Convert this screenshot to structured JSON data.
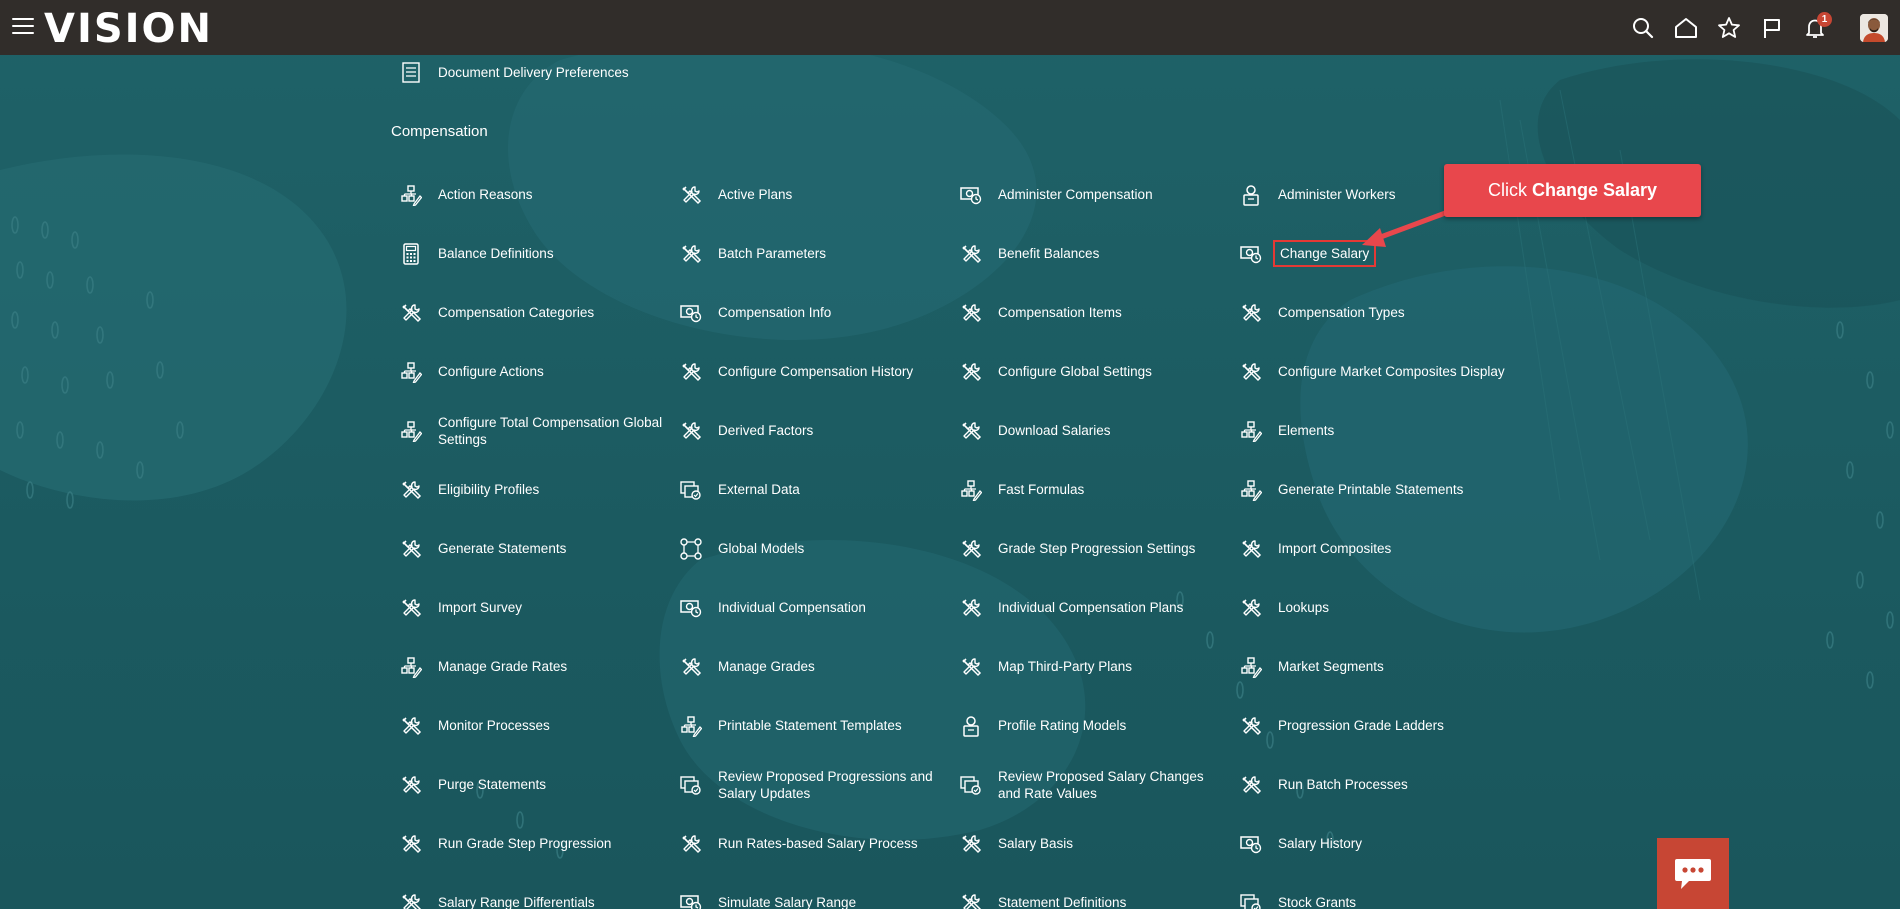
{
  "app": {
    "logo_text": "VISION",
    "notification_count": "1"
  },
  "icons": {
    "menu": "hamburger-icon",
    "search": "search-icon",
    "home": "home-icon",
    "favorites": "star-icon",
    "flag": "flag-icon",
    "notifications": "bell-icon",
    "chat": "chat-icon"
  },
  "colors": {
    "topbar": "#312d2a",
    "background": "#1d5c62",
    "callout": "#e8474c",
    "highlight": "#e53935",
    "chat": "#c74634"
  },
  "top_item": {
    "label": "Document Delivery Preferences",
    "icon": "document-icon"
  },
  "section": {
    "title": "Compensation"
  },
  "tasks": [
    {
      "label": "Action Reasons",
      "icon": "hierarchy-edit-icon"
    },
    {
      "label": "Active Plans",
      "icon": "tools-icon"
    },
    {
      "label": "Administer Compensation",
      "icon": "money-icon"
    },
    {
      "label": "Administer Workers",
      "icon": "person-icon"
    },
    {
      "label": "Balance Definitions",
      "icon": "calculator-icon"
    },
    {
      "label": "Batch Parameters",
      "icon": "tools-icon"
    },
    {
      "label": "Benefit Balances",
      "icon": "tools-icon"
    },
    {
      "label": "Change Salary",
      "icon": "money-icon"
    },
    {
      "label": "Compensation Categories",
      "icon": "tools-icon"
    },
    {
      "label": "Compensation Info",
      "icon": "money-icon"
    },
    {
      "label": "Compensation Items",
      "icon": "tools-icon"
    },
    {
      "label": "Compensation Types",
      "icon": "tools-icon"
    },
    {
      "label": "Configure Actions",
      "icon": "hierarchy-edit-icon"
    },
    {
      "label": "Configure Compensation History",
      "icon": "tools-icon"
    },
    {
      "label": "Configure Global Settings",
      "icon": "tools-icon"
    },
    {
      "label": "Configure Market Composites Display",
      "icon": "tools-icon"
    },
    {
      "label": "Configure Total Compensation Global Settings",
      "icon": "hierarchy-edit-icon"
    },
    {
      "label": "Derived Factors",
      "icon": "tools-icon"
    },
    {
      "label": "Download Salaries",
      "icon": "tools-icon"
    },
    {
      "label": "Elements",
      "icon": "hierarchy-edit-icon"
    },
    {
      "label": "Eligibility Profiles",
      "icon": "tools-icon"
    },
    {
      "label": "External Data",
      "icon": "documents-icon"
    },
    {
      "label": "Fast Formulas",
      "icon": "hierarchy-edit-icon"
    },
    {
      "label": "Generate Printable Statements",
      "icon": "hierarchy-edit-icon"
    },
    {
      "label": "Generate Statements",
      "icon": "tools-icon"
    },
    {
      "label": "Global Models",
      "icon": "network-icon"
    },
    {
      "label": "Grade Step Progression Settings",
      "icon": "tools-icon"
    },
    {
      "label": "Import Composites",
      "icon": "tools-icon"
    },
    {
      "label": "Import Survey",
      "icon": "tools-icon"
    },
    {
      "label": "Individual Compensation",
      "icon": "money-icon"
    },
    {
      "label": "Individual Compensation Plans",
      "icon": "tools-icon"
    },
    {
      "label": "Lookups",
      "icon": "tools-icon"
    },
    {
      "label": "Manage Grade Rates",
      "icon": "hierarchy-edit-icon"
    },
    {
      "label": "Manage Grades",
      "icon": "tools-icon"
    },
    {
      "label": "Map Third-Party Plans",
      "icon": "tools-icon"
    },
    {
      "label": "Market Segments",
      "icon": "hierarchy-edit-icon"
    },
    {
      "label": "Monitor Processes",
      "icon": "tools-icon"
    },
    {
      "label": "Printable Statement Templates",
      "icon": "hierarchy-edit-icon"
    },
    {
      "label": "Profile Rating Models",
      "icon": "person-icon"
    },
    {
      "label": "Progression Grade Ladders",
      "icon": "tools-icon"
    },
    {
      "label": "Purge Statements",
      "icon": "tools-icon"
    },
    {
      "label": "Review Proposed Progressions and Salary Updates",
      "icon": "documents-icon"
    },
    {
      "label": "Review Proposed Salary Changes and Rate Values",
      "icon": "documents-icon"
    },
    {
      "label": "Run Batch Processes",
      "icon": "tools-icon"
    },
    {
      "label": "Run Grade Step Progression",
      "icon": "tools-icon"
    },
    {
      "label": "Run Rates-based Salary Process",
      "icon": "tools-icon"
    },
    {
      "label": "Salary Basis",
      "icon": "tools-icon"
    },
    {
      "label": "Salary History",
      "icon": "money-icon"
    },
    {
      "label": "Salary Range Differentials",
      "icon": "tools-icon"
    },
    {
      "label": "Simulate Salary Range",
      "icon": "money-icon"
    },
    {
      "label": "Statement Definitions",
      "icon": "tools-icon"
    },
    {
      "label": "Stock Grants",
      "icon": "documents-icon"
    }
  ],
  "callout": {
    "prefix": "Click",
    "target": "Change Salary"
  }
}
